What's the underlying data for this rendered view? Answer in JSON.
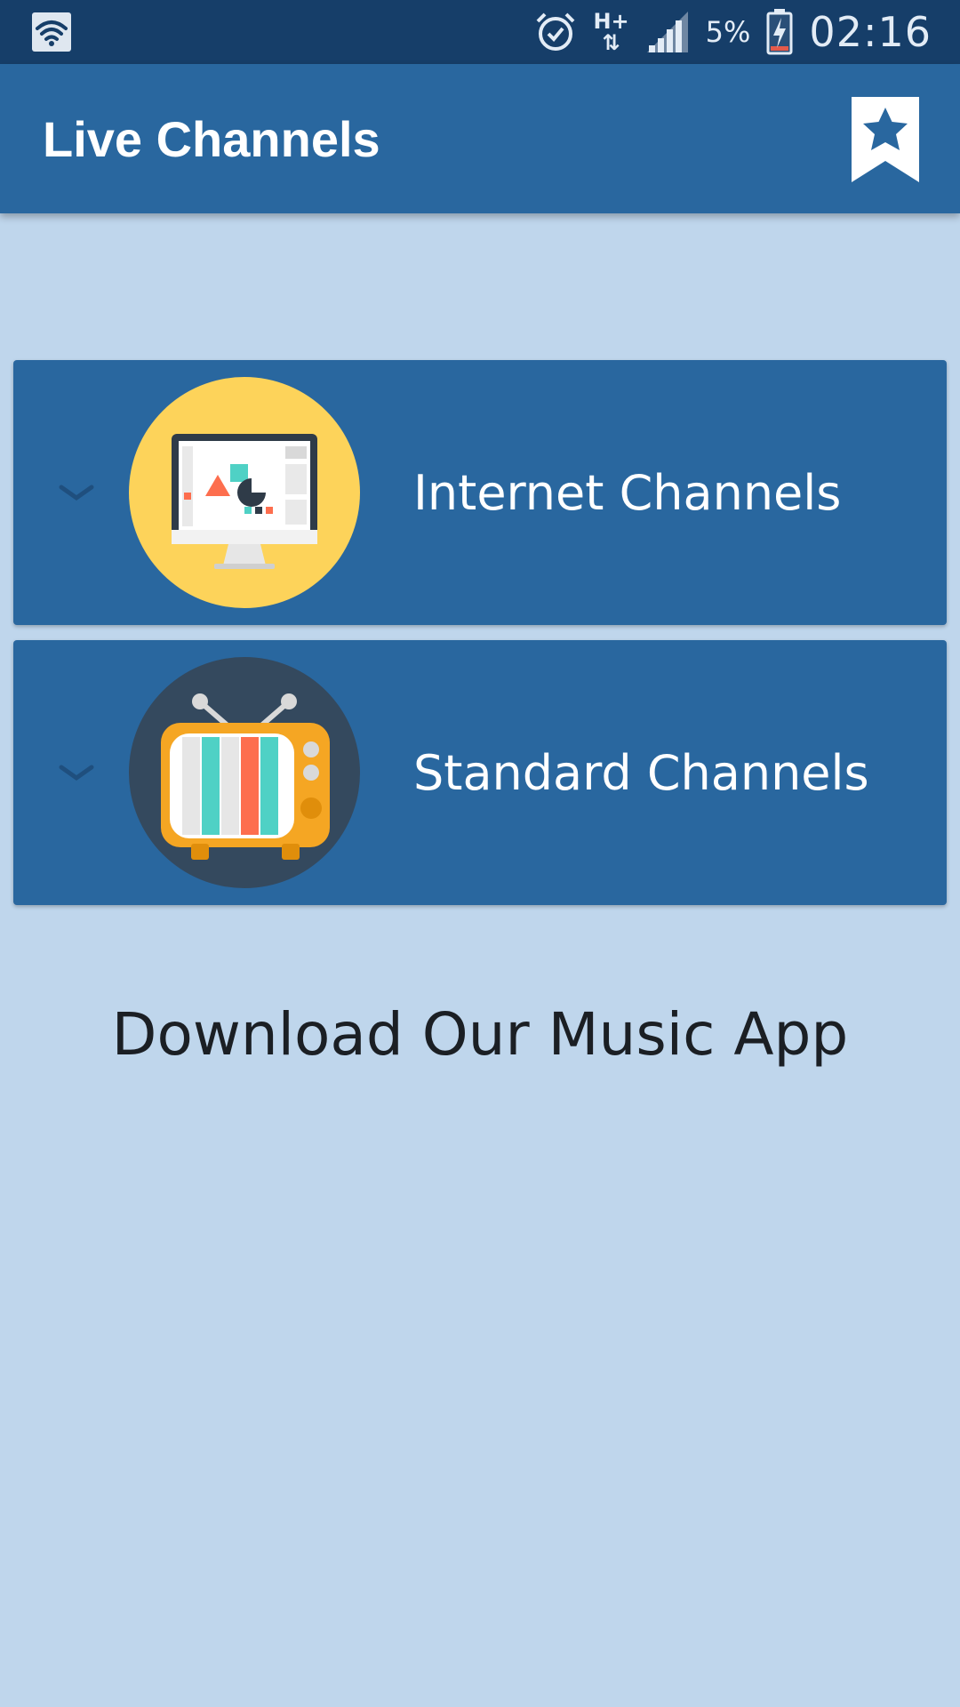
{
  "status_bar": {
    "network_type": "H+",
    "battery_percent": "5%",
    "time": "02:16",
    "icons": [
      "wifi-icon",
      "alarm-icon",
      "signal-icon",
      "battery-charging-icon"
    ]
  },
  "app_bar": {
    "title": "Live Channels",
    "bookmark_icon": "bookmark-star-icon"
  },
  "categories": [
    {
      "label": "Internet Channels",
      "icon": "computer-monitor-icon"
    },
    {
      "label": "Standard Channels",
      "icon": "retro-tv-icon"
    }
  ],
  "promo": {
    "text": "Download Our Music App"
  },
  "colors": {
    "status_bar": "#163e69",
    "app_bar": "#29679f",
    "card": "#29679f",
    "background": "#bfd6ec",
    "internet_icon_circle": "#fdd35a",
    "tv_icon_circle": "#34495e"
  }
}
